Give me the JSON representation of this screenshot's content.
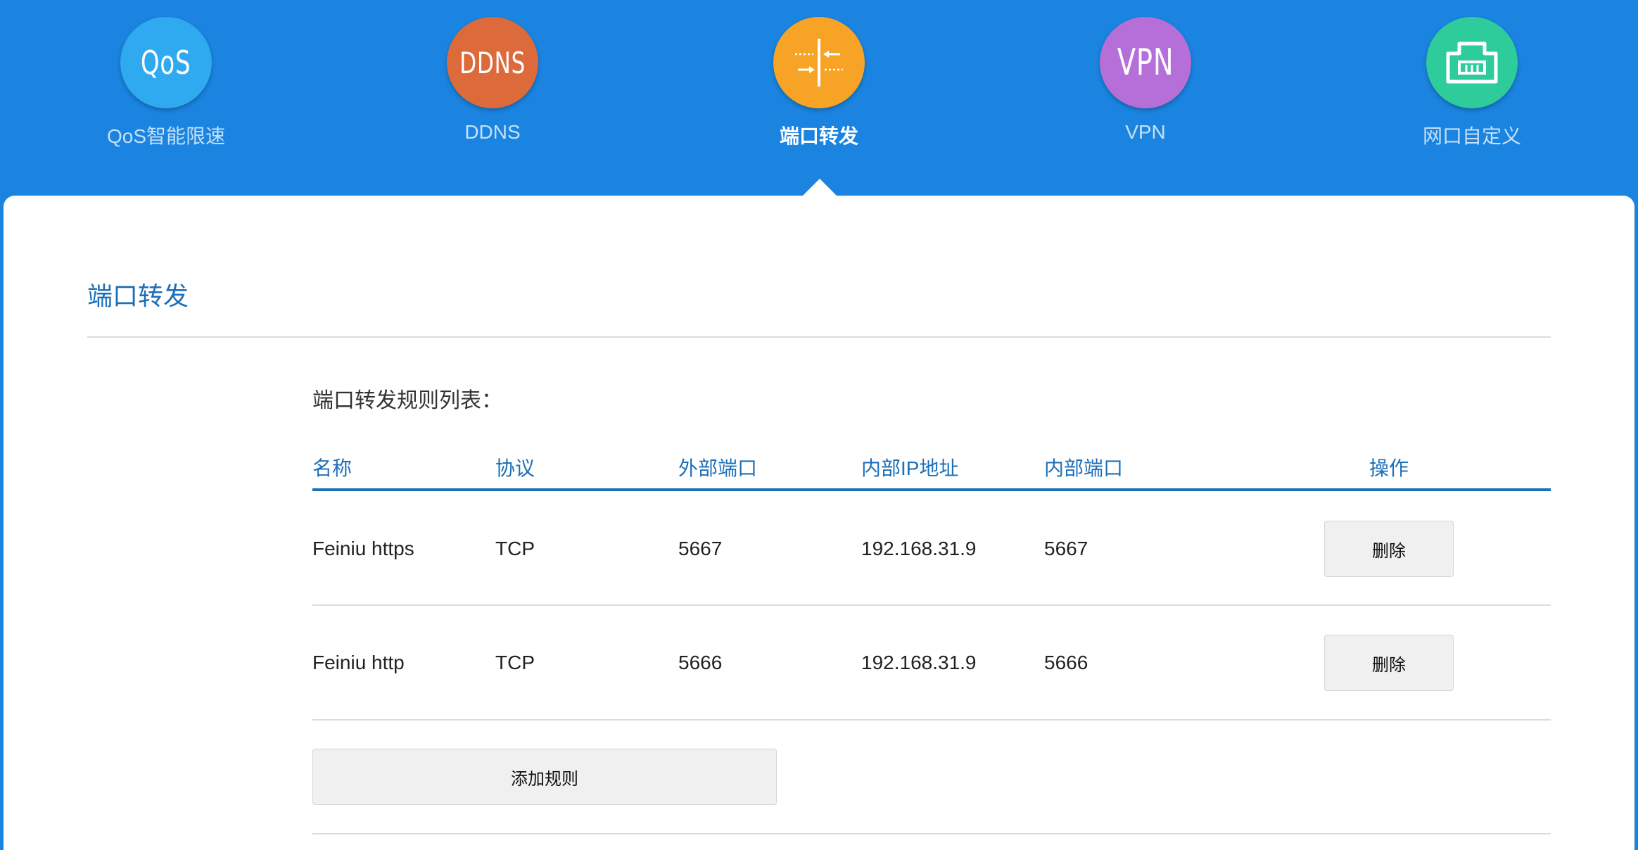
{
  "nav": {
    "items": [
      {
        "label": "QoS智能限速",
        "icon_text": "QoS",
        "icon": "qos-icon",
        "color": "#2fa9f0"
      },
      {
        "label": "DDNS",
        "icon_text": "DDNS",
        "icon": "ddns-icon",
        "color": "#dd6a3a"
      },
      {
        "label": "端口转发",
        "icon_text": "",
        "icon": "port-forward-icon",
        "color": "#f7a326"
      },
      {
        "label": "VPN",
        "icon_text": "VPN",
        "icon": "vpn-icon",
        "color": "#b66fd8"
      },
      {
        "label": "网口自定义",
        "icon_text": "",
        "icon": "ethernet-port-icon",
        "color": "#2ecc9a"
      }
    ],
    "active_index": 2
  },
  "section": {
    "title": "端口转发",
    "list_title": "端口转发规则列表："
  },
  "table": {
    "headers": [
      "名称",
      "协议",
      "外部端口",
      "内部IP地址",
      "内部端口",
      "操作"
    ],
    "rows": [
      {
        "name": "Feiniu https",
        "protocol": "TCP",
        "ext_port": "5667",
        "int_ip": "192.168.31.9",
        "int_port": "5667",
        "action": "删除"
      },
      {
        "name": "Feiniu http",
        "protocol": "TCP",
        "ext_port": "5666",
        "int_ip": "192.168.31.9",
        "int_port": "5666",
        "action": "删除"
      }
    ]
  },
  "add_button": "添加规则",
  "colors": {
    "header_bg": "#1a84e0",
    "accent": "#1d6fb8"
  }
}
